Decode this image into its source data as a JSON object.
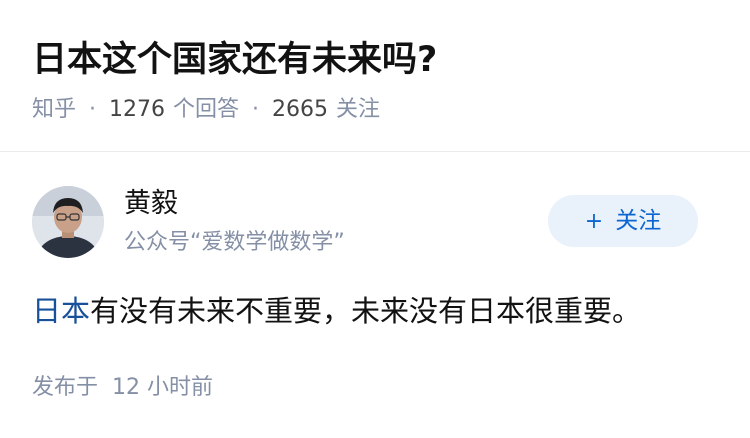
{
  "question": {
    "title": "日本这个国家还有未来吗?",
    "site": "知乎",
    "answers_count": "1276",
    "answers_label": "个回答",
    "follows_count": "2665",
    "follows_label": "关注"
  },
  "author": {
    "name": "黄毅",
    "bio": "公众号“爱数学做数学”",
    "avatar_icon": "person-avatar"
  },
  "follow_button": {
    "icon": "plus-icon",
    "label": "关注"
  },
  "answer": {
    "link_text": "日本",
    "text": "有没有未来不重要，未来没有日本很重要。"
  },
  "meta": {
    "posted_label": "发布于",
    "posted_time": "12 小时前"
  },
  "colors": {
    "link": "#175199",
    "accent": "#0d66d0",
    "muted": "#8590a6",
    "button_bg": "#e9f1fb"
  }
}
